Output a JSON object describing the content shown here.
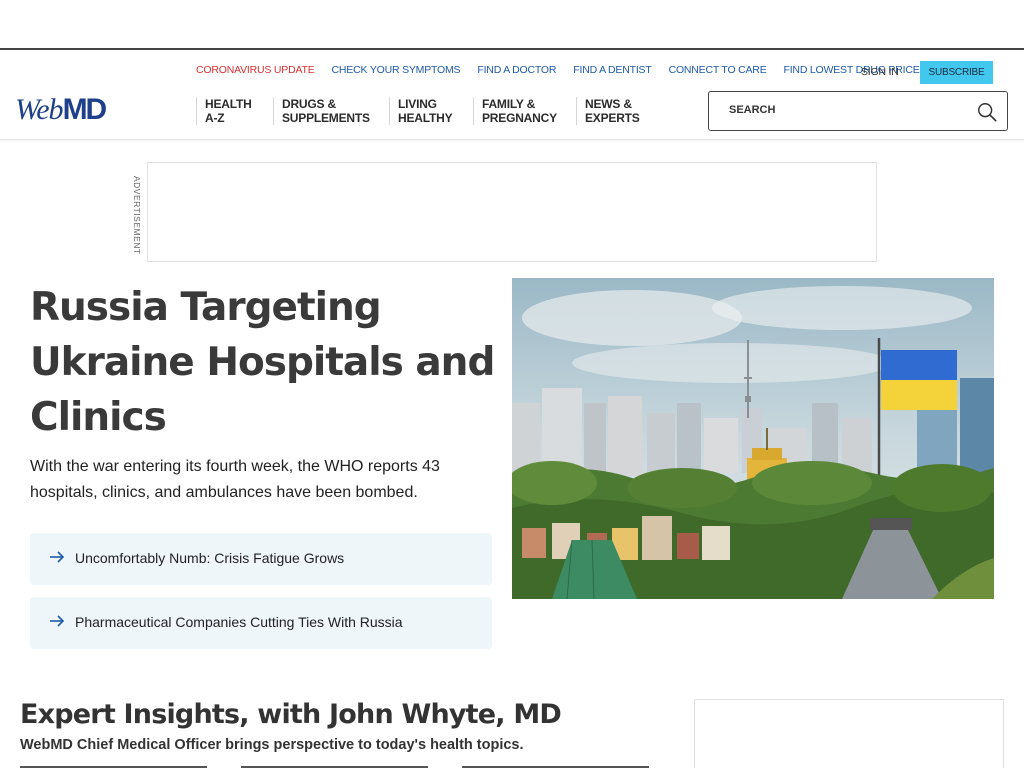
{
  "header": {
    "logo": {
      "web": "Web",
      "md": "MD"
    },
    "utility_links": [
      "CORONAVIRUS UPDATE",
      "CHECK YOUR SYMPTOMS",
      "FIND A DOCTOR",
      "FIND A DENTIST",
      "CONNECT TO CARE",
      "FIND LOWEST DRUG PRICES"
    ],
    "sign_in": "SIGN IN",
    "subscribe": "SUBSCRIBE",
    "nav": [
      "HEALTH\nA-Z",
      "DRUGS &\nSUPPLEMENTS",
      "LIVING\nHEALTHY",
      "FAMILY &\nPREGNANCY",
      "NEWS &\nEXPERTS"
    ],
    "search": {
      "placeholder": "SEARCH"
    }
  },
  "ad": {
    "label": "ADVERTISEMENT"
  },
  "story": {
    "headline": "Russia Targeting Ukraine Hospitals and Clinics",
    "dek": "With the war entering its fourth week, the WHO reports 43 hospitals, clinics, and ambulances have been bombed.",
    "related": [
      "Uncomfortably Numb: Crisis Fatigue Grows",
      "Pharmaceutical Companies Cutting Ties With Russia"
    ]
  },
  "experts": {
    "title": "Expert Insights, with John Whyte, MD",
    "subtitle": "WebMD Chief Medical Officer brings perspective to today's health topics."
  },
  "colors": {
    "brand_blue": "#1e3f8a",
    "link_blue": "#1e5aa8",
    "alert_red": "#d43232",
    "subscribe_cyan": "#42c7ee",
    "related_bg": "#eef6fa"
  }
}
